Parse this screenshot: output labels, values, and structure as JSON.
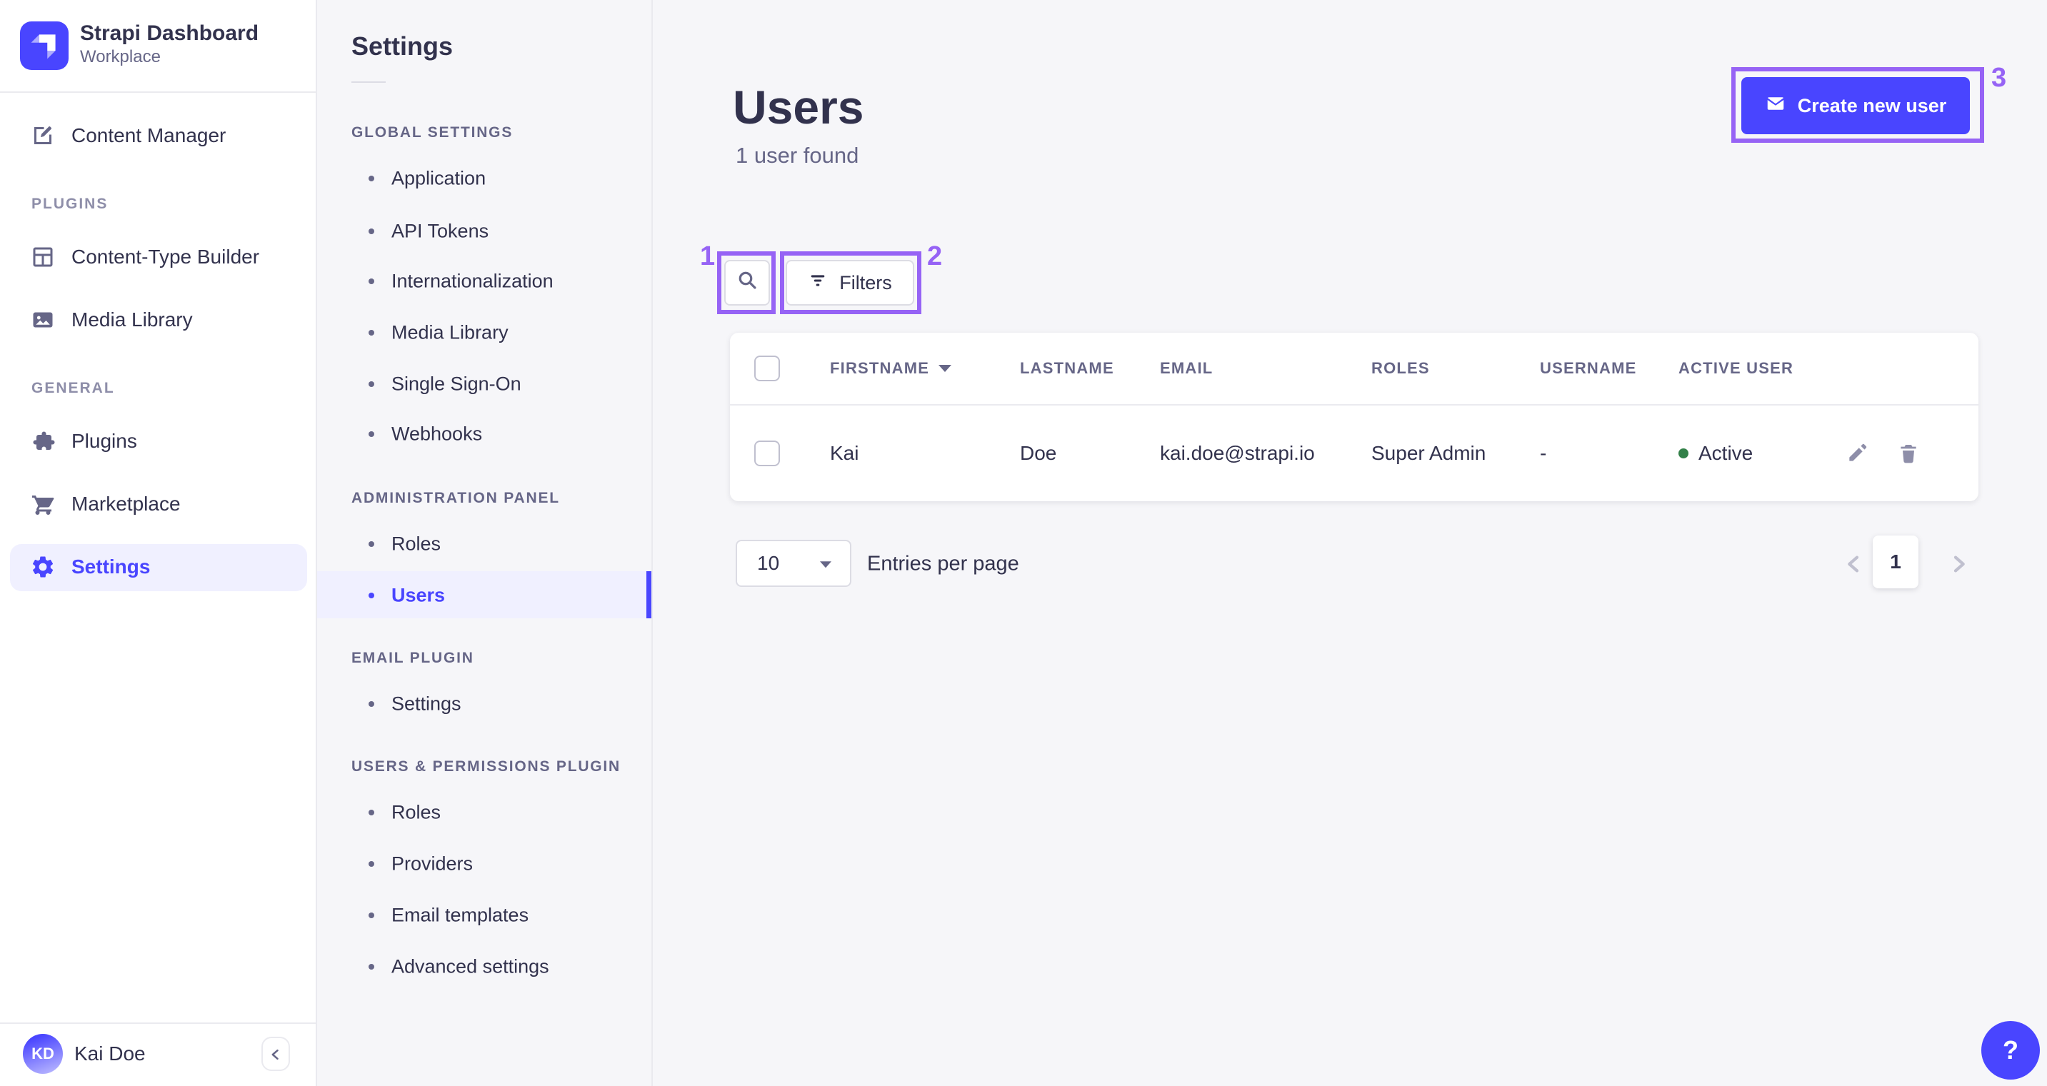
{
  "colors": {
    "primary": "#4945FF",
    "primary_light": "#F0F0FF",
    "background": "#F6F6F9",
    "border": "#EAEAEF",
    "input_border": "#DCDCE4",
    "text": "#32324D",
    "text_secondary": "#666687",
    "success_dot": "#328048",
    "annotation": "#9663F5"
  },
  "brand": {
    "name": "Strapi Dashboard",
    "workspace": "Workplace",
    "logo_icon": "strapi-logo-icon"
  },
  "main_nav": {
    "content_manager": {
      "label": "Content Manager",
      "icon": "content-manager-icon"
    },
    "plugins_section": "PLUGINS",
    "content_type_builder": {
      "label": "Content-Type Builder",
      "icon": "content-type-builder-icon"
    },
    "media_library": {
      "label": "Media Library",
      "icon": "media-library-icon"
    },
    "general_section": "GENERAL",
    "plugins": {
      "label": "Plugins",
      "icon": "puzzle-icon"
    },
    "marketplace": {
      "label": "Marketplace",
      "icon": "cart-icon"
    },
    "settings": {
      "label": "Settings",
      "icon": "gear-icon",
      "active": true
    },
    "user": {
      "initials": "KD",
      "name": "Kai Doe"
    },
    "collapse_icon": "chevron-left-icon"
  },
  "settings_nav": {
    "title": "Settings",
    "groups": [
      {
        "title": "GLOBAL SETTINGS",
        "items": [
          {
            "label": "Application"
          },
          {
            "label": "API Tokens"
          },
          {
            "label": "Internationalization"
          },
          {
            "label": "Media Library"
          },
          {
            "label": "Single Sign-On"
          },
          {
            "label": "Webhooks"
          }
        ]
      },
      {
        "title": "ADMINISTRATION PANEL",
        "items": [
          {
            "label": "Roles"
          },
          {
            "label": "Users",
            "active": true
          }
        ]
      },
      {
        "title": "EMAIL PLUGIN",
        "items": [
          {
            "label": "Settings"
          }
        ]
      },
      {
        "title": "USERS & PERMISSIONS PLUGIN",
        "items": [
          {
            "label": "Roles"
          },
          {
            "label": "Providers"
          },
          {
            "label": "Email templates"
          },
          {
            "label": "Advanced settings"
          }
        ]
      }
    ]
  },
  "page_header": {
    "title": "Users",
    "subtitle": "1 user found",
    "create_button": {
      "label": "Create new user",
      "icon": "mail-icon"
    },
    "search_button": {
      "icon": "search-icon"
    },
    "filters_button": {
      "label": "Filters",
      "icon": "filter-icon"
    }
  },
  "annotations": [
    {
      "id": "1",
      "target": "search-button"
    },
    {
      "id": "2",
      "target": "filters-button"
    },
    {
      "id": "3",
      "target": "create-new-user-button"
    }
  ],
  "table": {
    "columns": [
      "FIRSTNAME",
      "LASTNAME",
      "EMAIL",
      "ROLES",
      "USERNAME",
      "ACTIVE USER"
    ],
    "sorted_by": "FIRSTNAME",
    "row_icons": [
      "edit-pencil-icon",
      "trash-icon"
    ],
    "rows": [
      {
        "firstname": "Kai",
        "lastname": "Doe",
        "email": "kai.doe@strapi.io",
        "roles": "Super Admin",
        "username": "-",
        "active": "Active"
      }
    ]
  },
  "pagination": {
    "entries_value": "10",
    "entries_label": "Entries per page",
    "current_page": "1",
    "prev_icon": "chevron-left-icon",
    "next_icon": "chevron-right-icon"
  },
  "help_button": {
    "label": "?",
    "icon": "question-mark-icon"
  }
}
